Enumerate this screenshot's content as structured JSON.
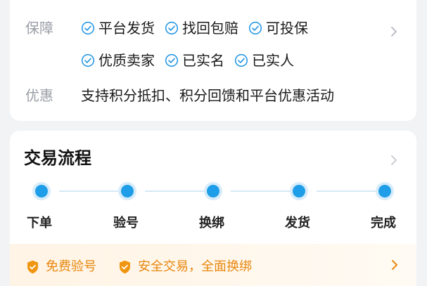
{
  "guarantee": {
    "label": "保障",
    "tags_row1": [
      "平台发货",
      "找回包赔",
      "可投保"
    ],
    "tags_row2": [
      "优质卖家",
      "已实名",
      "已实人"
    ]
  },
  "offers": {
    "label": "优惠",
    "text": "支持积分抵扣、积分回馈和平台优惠活动"
  },
  "process": {
    "title": "交易流程",
    "steps": [
      "下单",
      "验号",
      "换绑",
      "发货",
      "完成"
    ],
    "badges": [
      "免费验号",
      "安全交易，全面换绑"
    ]
  },
  "colors": {
    "accent": "#1e9de8",
    "warning": "#e8870e",
    "check_icon": "#2a9ae4"
  },
  "icons": {
    "tag": "check-circle-icon",
    "badge": "shield-check-icon",
    "more": "chevron-right-icon"
  }
}
